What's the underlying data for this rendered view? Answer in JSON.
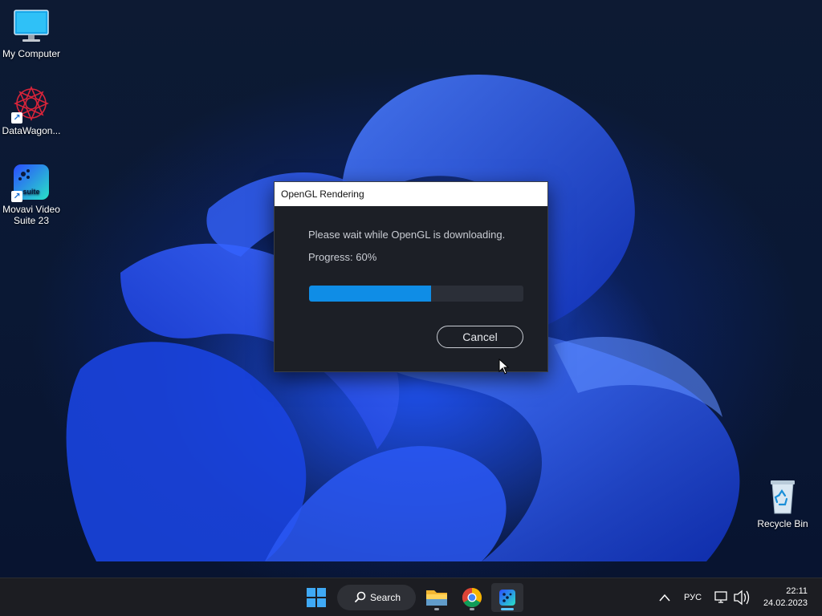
{
  "desktop": {
    "icons": [
      {
        "label": "My Computer",
        "icon": "monitor-icon"
      },
      {
        "label": "DataWagon...",
        "icon": "datawagon-icon"
      },
      {
        "label": "Movavi Video Suite 23",
        "icon": "movavi-suite-icon"
      },
      {
        "label": "Recycle Bin",
        "icon": "recycle-bin-icon"
      }
    ]
  },
  "dialog": {
    "title": "OpenGL Rendering",
    "message": "Please wait while OpenGL is downloading.",
    "progress_text": "Progress: 60%",
    "progress_fraction": 0.57,
    "cancel_label": "Cancel",
    "accent_color": "#0f8de6"
  },
  "taskbar": {
    "search_label": "Search",
    "apps": [
      {
        "name": "start",
        "icon": "windows-start-icon"
      },
      {
        "name": "search",
        "icon": "search-icon"
      },
      {
        "name": "file-explorer",
        "icon": "folder-icon"
      },
      {
        "name": "chrome",
        "icon": "chrome-icon"
      },
      {
        "name": "movavi",
        "icon": "movavi-icon"
      }
    ],
    "language": "РУС",
    "time": "22:11",
    "date": "24.02.2023"
  }
}
